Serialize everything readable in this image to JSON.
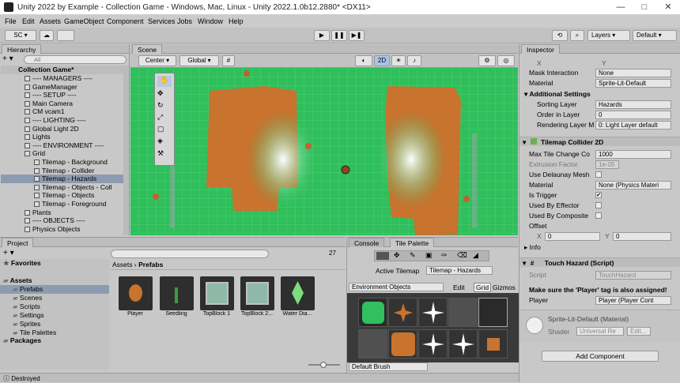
{
  "window": {
    "title": "Unity 2022 by Example - Collection Game - Windows, Mac, Linux - Unity 2022.1.0b12.2880* <DX11>",
    "minimize": "—",
    "maximize": "□",
    "close": "✕"
  },
  "menu": [
    "File",
    "Edit",
    "Assets",
    "GameObject",
    "Component",
    "Services",
    "Jobs",
    "Window",
    "Help"
  ],
  "toolbar": {
    "account": "SC ▾",
    "layers": "Layers",
    "layout": "Default",
    "play": "▶",
    "pause": "❚❚",
    "step": "▶❚"
  },
  "hierarchy": {
    "tab": "Hierarchy",
    "search_placeholder": "All",
    "scene": "Collection Game*",
    "items": [
      {
        "label": "---- MANAGERS ----",
        "indent": 2
      },
      {
        "label": "GameManager",
        "indent": 2
      },
      {
        "label": "---- SETUP ----",
        "indent": 2
      },
      {
        "label": "Main Camera",
        "indent": 2
      },
      {
        "label": "CM vcam1",
        "indent": 2
      },
      {
        "label": "---- LIGHTING ----",
        "indent": 2
      },
      {
        "label": "Global Light 2D",
        "indent": 2
      },
      {
        "label": "Lights",
        "indent": 2
      },
      {
        "label": "---- ENVIRONMENT ----",
        "indent": 2
      },
      {
        "label": "Grid",
        "indent": 2
      },
      {
        "label": "Tilemap - Background",
        "indent": 3
      },
      {
        "label": "Tilemap - Collider",
        "indent": 3
      },
      {
        "label": "Tilemap - Hazards",
        "indent": 3
      },
      {
        "label": "Tilemap - Objects - Coll",
        "indent": 3
      },
      {
        "label": "Tilemap - Objects",
        "indent": 3
      },
      {
        "label": "Tilemap - Foreground",
        "indent": 3
      },
      {
        "label": "Plants",
        "indent": 2
      },
      {
        "label": "---- OBJECTS ----",
        "indent": 2
      },
      {
        "label": "Physics Objects",
        "indent": 2
      }
    ]
  },
  "scene": {
    "tab": "Scene",
    "pivot": "Center",
    "space": "Global",
    "mode_2d": "2D"
  },
  "project": {
    "tab": "Project",
    "add": "+ ▾",
    "count": "27",
    "breadcrumb_root": "Assets",
    "breadcrumb_sep": "›",
    "breadcrumb_leaf": "Prefabs",
    "tree": [
      {
        "label": "Favorites",
        "bold": true,
        "indent": 0
      },
      {
        "label": "Assets",
        "bold": true,
        "indent": 0
      },
      {
        "label": "Prefabs",
        "indent": 1
      },
      {
        "label": "Scenes",
        "indent": 1
      },
      {
        "label": "Scripts",
        "indent": 1
      },
      {
        "label": "Settings",
        "indent": 1
      },
      {
        "label": "Sprites",
        "indent": 1
      },
      {
        "label": "Tile Palettes",
        "indent": 1
      },
      {
        "label": "Packages",
        "bold": true,
        "indent": 0
      }
    ],
    "assets": [
      "Player",
      "Seedling",
      "TopBlock 1",
      "TopBlock 2...",
      "Water Dia..."
    ],
    "status": "Destroyed"
  },
  "palette": {
    "tab_console": "Console",
    "tab_palette": "Tile Palette",
    "active_label": "Active Tilemap",
    "active_value": "Tilemap - Hazards",
    "env": "Environment Objects",
    "edit": "Edit",
    "grid": "Grid",
    "gizmos": "Gizmos",
    "brush": "Default Brush"
  },
  "inspector": {
    "tab": "Inspector",
    "x_label": "X",
    "y_label": "Y",
    "mask_label": "Mask Interaction",
    "mask_value": "None",
    "material_label": "Material",
    "material_value": "Sprite-Lit-Default",
    "additional": "Additional Settings",
    "sorting_layer_label": "Sorting Layer",
    "sorting_layer_value": "Hazards",
    "order_label": "Order in Layer",
    "order_value": "0",
    "render_label": "Rendering Layer M",
    "render_value": "0: Light Layer default",
    "collider_title": "Tilemap Collider 2D",
    "max_tile_label": "Max Tile Change Co",
    "max_tile_value": "1000",
    "extrusion_label": "Extrusion Factor",
    "extrusion_value": "1e-05",
    "delaunay_label": "Use Delaunay Mesh",
    "coll_material_label": "Material",
    "coll_material_value": "None (Physics Materi",
    "trigger_label": "Is Trigger",
    "effector_label": "Used By Effector",
    "composite_label": "Used By Composite",
    "offset_label": "Offset",
    "offset_x": "0",
    "offset_y": "0",
    "info_label": "Info",
    "touch_title": "Touch Hazard (Script)",
    "script_label": "Script",
    "script_value": "TouchHazard",
    "note": "Make sure the 'Player' tag is also assigned!",
    "player_label": "Player",
    "player_value": "Player (Player Cont",
    "mat_name": "Sprite-Lit-Default (Material)",
    "shader_label": "Shader",
    "shader_value": "Universal Re",
    "shader_edit": "Edit...",
    "add_component": "Add Component"
  },
  "colors": {
    "grass": "#2fbf5c",
    "dirt": "#c8732e",
    "selection": "#8d9bb0"
  }
}
